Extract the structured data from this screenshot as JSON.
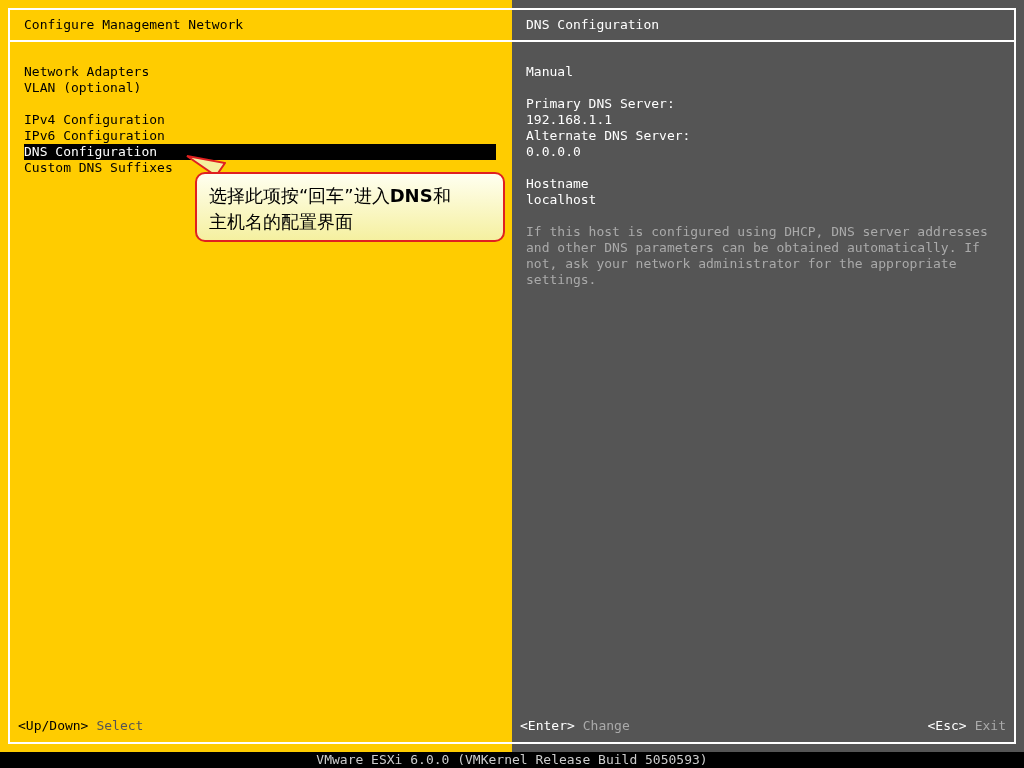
{
  "left_panel": {
    "title": "Configure Management Network",
    "menu_groups": [
      [
        {
          "label": "Network Adapters",
          "selected": false
        },
        {
          "label": "VLAN (optional)",
          "selected": false
        }
      ],
      [
        {
          "label": "IPv4 Configuration",
          "selected": false
        },
        {
          "label": "IPv6 Configuration",
          "selected": false
        },
        {
          "label": "DNS Configuration",
          "selected": true
        },
        {
          "label": "Custom DNS Suffixes",
          "selected": false
        }
      ]
    ],
    "callout": "选择此项按“回车”进入**DNS**和主机名的配置界面",
    "hints": [
      {
        "key": "<Up/Down>",
        "action": "Select"
      }
    ]
  },
  "right_panel": {
    "title": "DNS Configuration",
    "groups": [
      [
        "Manual"
      ],
      [
        "Primary DNS Server:",
        "192.168.1.1",
        "Alternate DNS Server:",
        "0.0.0.0"
      ],
      [
        "Hostname",
        "localhost"
      ]
    ],
    "help": "If this host is configured using DHCP, DNS server addresses and other DNS parameters can be obtained automatically. If not, ask your network administrator for the appropriate settings.",
    "hints": [
      {
        "key": "<Enter>",
        "action": "Change"
      },
      {
        "key": "<Esc>",
        "action": "Exit"
      }
    ]
  },
  "status_bar": "VMware ESXi 6.0.0 (VMKernel Release Build 5050593)"
}
